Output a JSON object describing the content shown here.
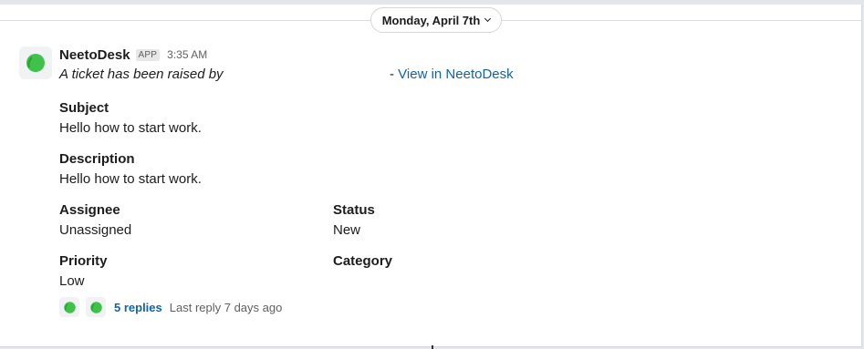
{
  "date_divider": {
    "label": "Monday, April 7th"
  },
  "message": {
    "sender": "NeetoDesk",
    "badge": "APP",
    "time": "3:35 AM",
    "raised_text": "A ticket has been raised by",
    "view_prefix": "- ",
    "view_link": "View in NeetoDesk",
    "fields": {
      "subject_label": "Subject",
      "subject_value": "Hello how to start work.",
      "description_label": "Description",
      "description_value": "Hello how to start work.",
      "assignee_label": "Assignee",
      "assignee_value": "Unassigned",
      "status_label": "Status",
      "status_value": "New",
      "priority_label": "Priority",
      "priority_value": "Low",
      "category_label": "Category"
    }
  },
  "thread": {
    "replies": "5 replies",
    "last_reply": "Last reply 7 days ago"
  },
  "colors": {
    "link": "#1264a3",
    "avatar_green": "#3fc24a",
    "divider": "#dddddd"
  },
  "icons": {
    "avatar": "neetodesk-logo-icon",
    "date_chevron": "chevron-down-icon"
  }
}
